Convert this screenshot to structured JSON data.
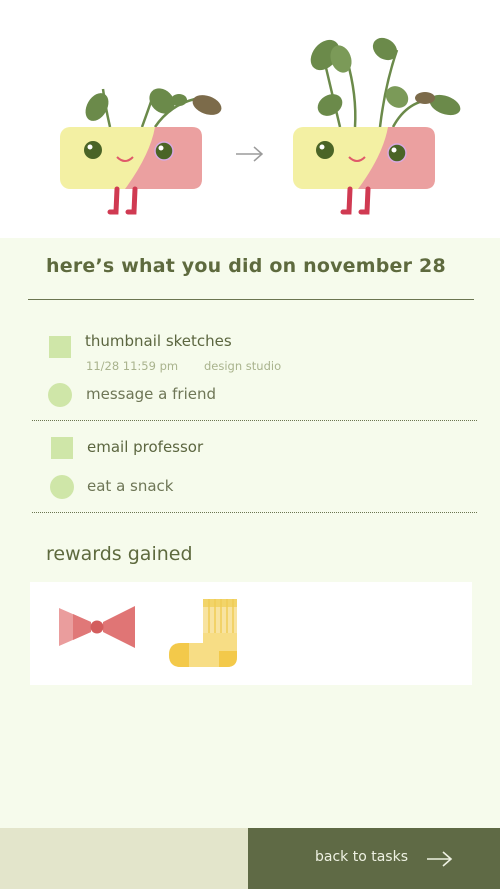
{
  "summary": {
    "title": "here’s what you did on november 28"
  },
  "tasks": [
    {
      "shape": "square",
      "label": "thumbnail sketches",
      "time": "11/28 11:59 pm",
      "category": "design studio"
    },
    {
      "shape": "circle",
      "label": "message a friend"
    },
    {
      "shape": "square",
      "label": "email professor"
    },
    {
      "shape": "circle",
      "label": "eat a snack"
    }
  ],
  "rewards": {
    "title": "rewards gained",
    "items": [
      {
        "icon": "bow-tie-icon"
      },
      {
        "icon": "sock-icon"
      }
    ]
  },
  "footer": {
    "back_label": "back to tasks",
    "arrow_icon": "arrow-right-icon"
  },
  "colors": {
    "panel_bg": "#f6fbec",
    "accent_green": "#cfe6a8",
    "dark_olive": "#5f6a45",
    "footer_light": "#e3e5cb"
  }
}
